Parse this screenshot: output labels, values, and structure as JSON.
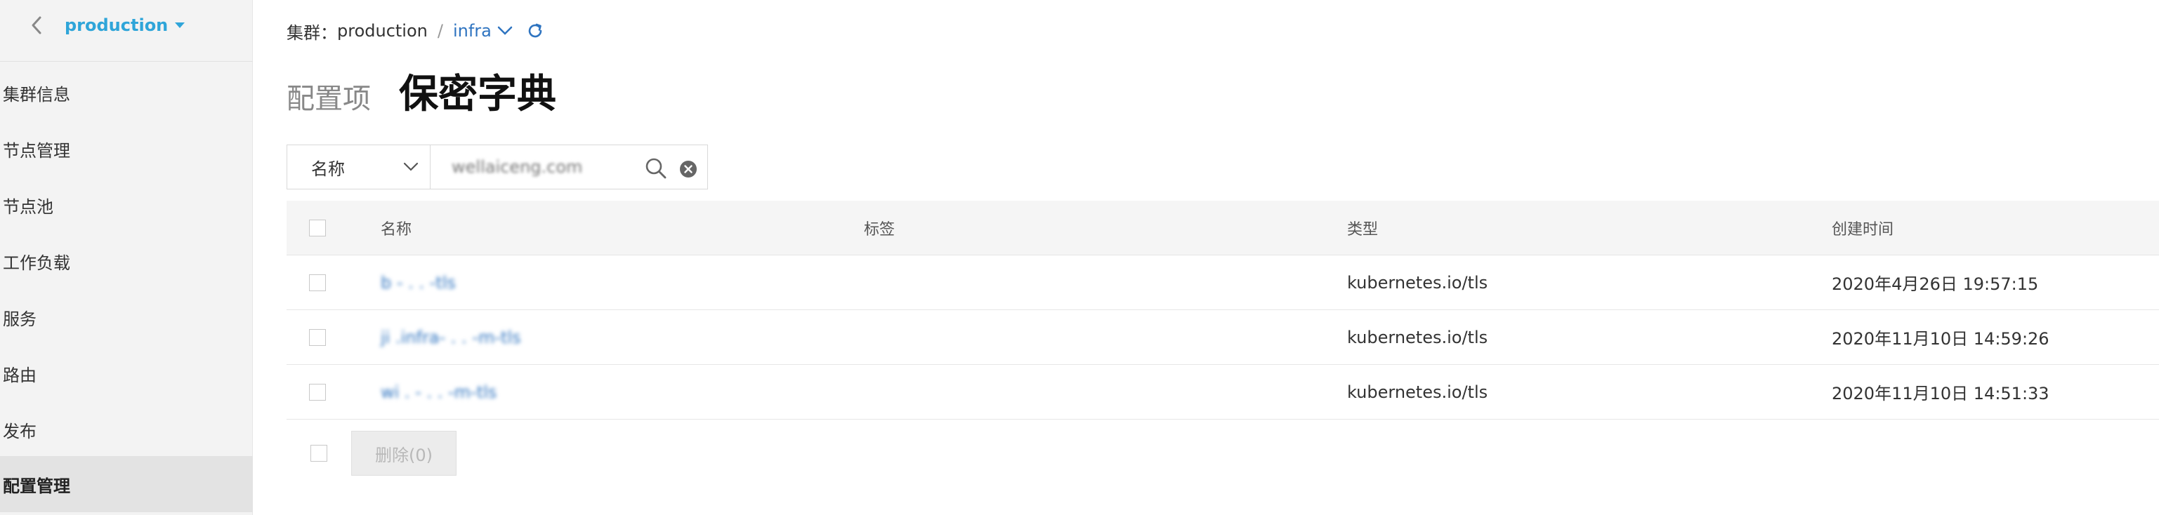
{
  "sidebar": {
    "back_icon": "chevron-left-icon",
    "cluster_name": "production",
    "items": [
      {
        "label": "集群信息"
      },
      {
        "label": "节点管理"
      },
      {
        "label": "节点池"
      },
      {
        "label": "工作负载"
      },
      {
        "label": "服务"
      },
      {
        "label": "路由"
      },
      {
        "label": "发布"
      },
      {
        "label": "配置管理",
        "active": true
      }
    ]
  },
  "breadcrumb": {
    "cluster_label": "集群：",
    "cluster_value": "production",
    "separator": "/",
    "namespace": "infra"
  },
  "tabs": {
    "configmap": "配置项",
    "secret": "保密字典"
  },
  "search": {
    "field_label": "名称",
    "value": "wellaiceng.com"
  },
  "table": {
    "headers": {
      "name": "名称",
      "labels": "标签",
      "type": "类型",
      "created": "创建时间"
    },
    "rows": [
      {
        "name": "b      -      .      .   -tls",
        "labels": "",
        "type": "kubernetes.io/tls",
        "created": "2020年4月26日 19:57:15"
      },
      {
        "name": "ji   .infra-    .      .   -m-tls",
        "labels": "",
        "type": "kubernetes.io/tls",
        "created": "2020年11月10日 14:59:26"
      },
      {
        "name": "wi    .   -    .      .  -m-tls",
        "labels": "",
        "type": "kubernetes.io/tls",
        "created": "2020年11月10日 14:51:33"
      }
    ]
  },
  "footer": {
    "delete_label": "删除(0)"
  },
  "colors": {
    "accent": "#2fa5d9",
    "link": "#2f74c0",
    "sidebar_bg": "#f3f3f3",
    "active_item_bg": "#e3e3e3",
    "header_bg": "#f5f5f5"
  }
}
